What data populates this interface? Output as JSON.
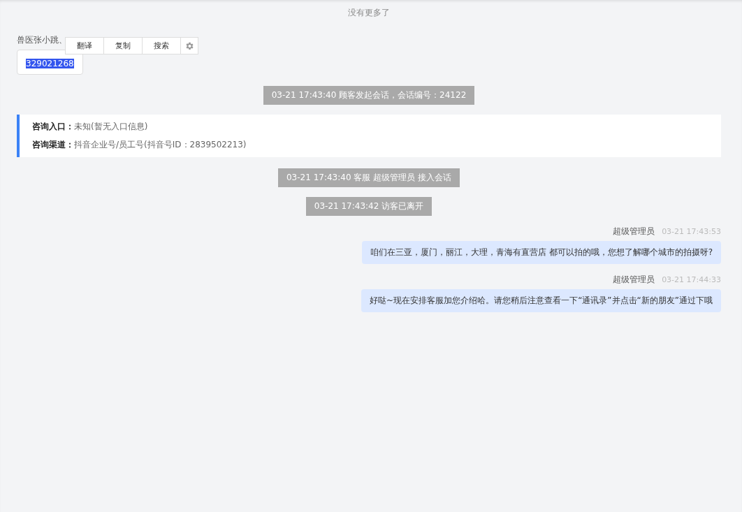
{
  "no_more": "没有更多了",
  "items": [
    {
      "kind": "incoming",
      "sender": "兽医张小跳、",
      "text": "329021268",
      "text_selected": true,
      "menu": {
        "actions": [
          "翻译",
          "复制",
          "搜索"
        ]
      }
    },
    {
      "kind": "system",
      "text": "03-21 17:43:40 顾客发起会话，会话编号：24122"
    },
    {
      "kind": "info",
      "rows": [
        {
          "label": "咨询入口：",
          "value": "未知(暂无入口信息)"
        },
        {
          "label": "咨询渠道：",
          "value": "抖音企业号/员工号(抖音号ID：2839502213)"
        }
      ]
    },
    {
      "kind": "system",
      "text": "03-21 17:43:40 客服 超级管理员 接入会话"
    },
    {
      "kind": "system",
      "text": "03-21 17:43:42 访客已离开"
    },
    {
      "kind": "outgoing",
      "sender": "超级管理员",
      "time": "03-21 17:43:53",
      "text": "咱们在三亚，厦门，丽江，大理，青海有直营店 都可以拍的哦，您想了解哪个城市的拍摄呀?"
    },
    {
      "kind": "outgoing",
      "sender": "超级管理员",
      "time": "03-21 17:44:33",
      "text": "好哒~现在安排客服加您介绍哈。请您稍后注意查看一下“通讯录”并点击“新的朋友”通过下哦"
    }
  ]
}
